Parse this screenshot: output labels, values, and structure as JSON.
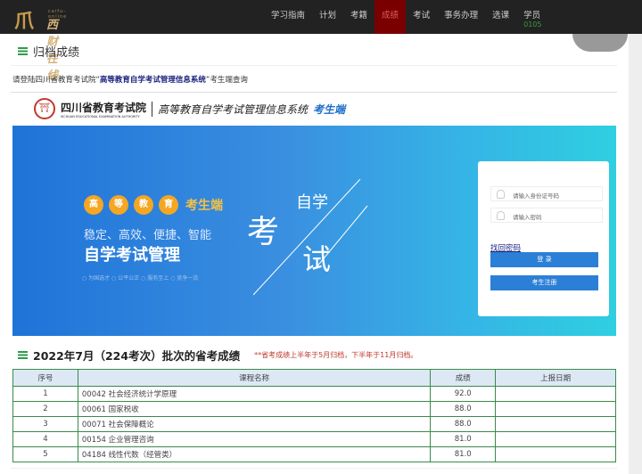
{
  "nav": {
    "logo_en": "caifu-online",
    "logo_cn": "西财在线",
    "items": [
      {
        "label": "学习指南"
      },
      {
        "label": "计划"
      },
      {
        "label": "考籍"
      },
      {
        "label": "成绩",
        "active": true
      },
      {
        "label": "考试"
      },
      {
        "label": "事务办理"
      },
      {
        "label": "选课"
      },
      {
        "label": "学员",
        "sub": "0105"
      }
    ],
    "active_color": "#7a0000"
  },
  "page": {
    "title": "归档成绩",
    "notice_prefix": "请登陆四川省教育考试院“",
    "notice_link": "高等教育自学考试管理信息系统",
    "notice_suffix": "”考生端查询"
  },
  "banner": {
    "org": "四川省教育考试院",
    "org_en": "SICHUAN EDUCATIONAL EXAMINATION AUTHORITY",
    "system": "高等教育自学考试管理信息系统",
    "client": "考生端",
    "circles": [
      "高",
      "等",
      "教",
      "育"
    ],
    "circle_suffix": "考生端",
    "slogan": "稳定、高效、便捷、智能",
    "headline": "自学考试管理",
    "tags": "○ 为国选才 ○ 公平公正 ○ 服务至上 ○ 竞争一流",
    "art": [
      "考",
      "自学",
      "试"
    ],
    "login": {
      "id_placeholder": "请输入身份证号码",
      "pwd_placeholder": "请输入密码",
      "forgot": "找回密码",
      "login": "登 录",
      "register": "考生注册"
    }
  },
  "scores": {
    "title": "2022年7月（224考次）批次的省考成绩",
    "note": "**省考成绩上半年于5月归档，下半年于11月归档。",
    "headers": [
      "序号",
      "课程名称",
      "成绩",
      "上报日期"
    ],
    "rows": [
      [
        "1",
        "00042 社会经济统计学原理",
        "92.0",
        ""
      ],
      [
        "2",
        "00061 国家税收",
        "88.0",
        ""
      ],
      [
        "3",
        "00071 社会保障概论",
        "88.0",
        ""
      ],
      [
        "4",
        "00154 企业管理咨询",
        "81.0",
        ""
      ],
      [
        "5",
        "04184 线性代数（经管类）",
        "81.0",
        ""
      ]
    ]
  }
}
